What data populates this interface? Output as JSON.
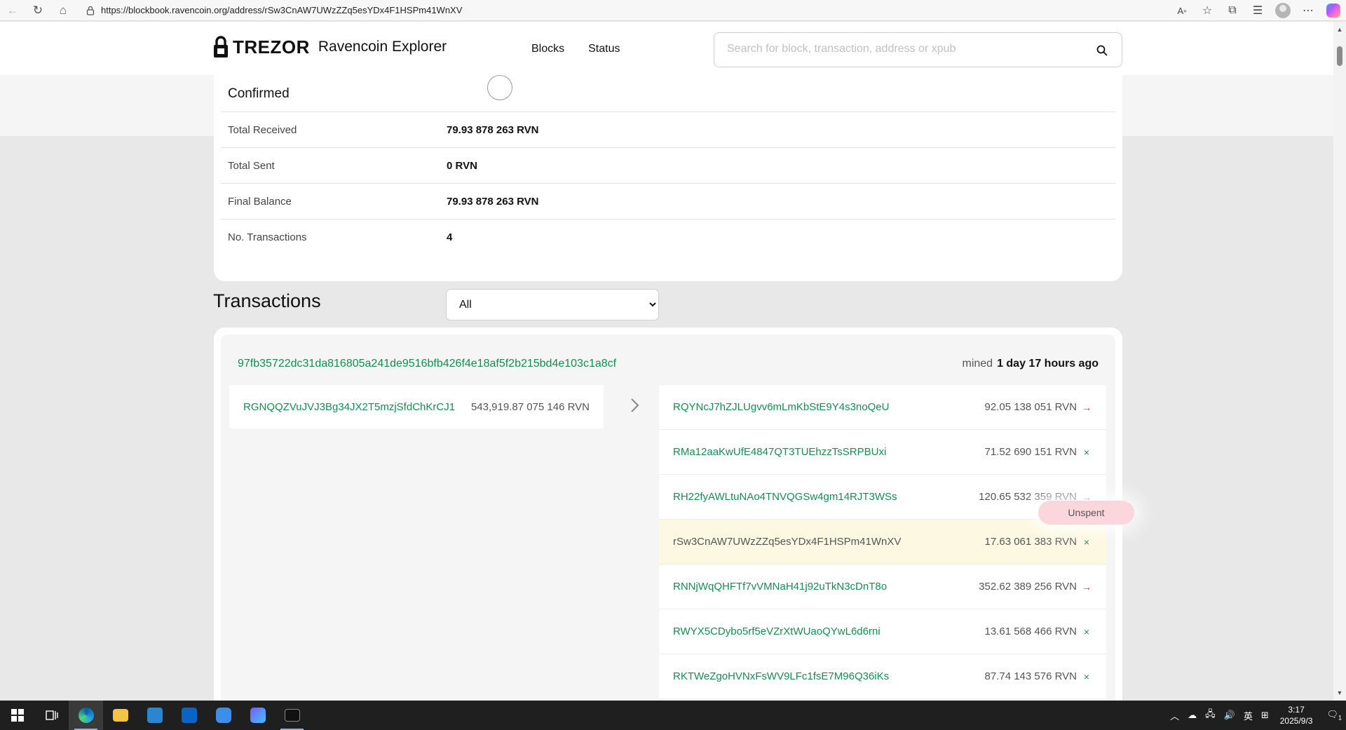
{
  "browser": {
    "url": "https://blockbook.ravencoin.org/address/rSw3CnAW7UWzZZq5esYDx4F1HSPm41WnXV"
  },
  "header": {
    "logo_text": "TREZOR",
    "subtitle": "Ravencoin Explorer",
    "nav": [
      "Blocks",
      "Status"
    ],
    "search_placeholder": "Search for block, transaction, address or xpub"
  },
  "confirmed": {
    "title": "Confirmed",
    "rows": [
      {
        "label": "Total Received",
        "value": "79.93 878 263 RVN"
      },
      {
        "label": "Total Sent",
        "value": "0 RVN"
      },
      {
        "label": "Final Balance",
        "value": "79.93 878 263 RVN"
      },
      {
        "label": "No. Transactions",
        "value": "4"
      }
    ]
  },
  "transactions": {
    "heading": "Transactions",
    "filter_selected": "All",
    "tx": {
      "hash": "97fb35722dc31da816805a241de9516bfb426f4e18af5f2b215bd4e103c1a8cf",
      "mined_label": "mined",
      "mined_ago": "1 day 17 hours ago",
      "input": {
        "address": "RGNQQZVuJVJ3Bg34JX2T5mzjSfdChKrCJ1",
        "amount": "543,919.87 075 146 RVN"
      },
      "outputs": [
        {
          "address": "RQYNcJ7hZJLUgvv6mLmKbStE9Y4s3noQeU",
          "amount": "92.05 138 051 RVN",
          "status": "spent",
          "mark": "→"
        },
        {
          "address": "RMa12aaKwUfE4847QT3TUEhzzTsSRPBUxi",
          "amount": "71.52 690 151 RVN",
          "status": "unspent",
          "mark": "×"
        },
        {
          "address": "RH22fyAWLtuNAo4TNVQGSw4gm14RJT3WSs",
          "amount": "120.65 532 359 RVN",
          "status": "spent",
          "mark": "→"
        },
        {
          "address": "rSw3CnAW7UWzZZq5esYDx4F1HSPm41WnXV",
          "amount": "17.63 061 383 RVN",
          "status": "unspent",
          "mark": "×"
        },
        {
          "address": "RNNjWqQHFTf7vVMNaH41j92uTkN3cDnT8o",
          "amount": "352.62 389 256 RVN",
          "status": "spent",
          "mark": "→"
        },
        {
          "address": "RWYX5CDybo5rf5eVZrXtWUaoQYwL6d6rni",
          "amount": "13.61 568 466 RVN",
          "status": "unspent",
          "mark": "×"
        },
        {
          "address": "RKTWeZgoHVNxFsWV9LFc1fsE7M96Q36iKs",
          "amount": "87.74 143 576 RVN",
          "status": "unspent",
          "mark": "×"
        }
      ]
    },
    "tooltip": "Unspent"
  },
  "taskbar": {
    "time": "3:17",
    "date": "2025/9/3",
    "ime": "英",
    "notification_count": "1"
  },
  "colors": {
    "link_green": "#168c53",
    "spent_red": "#d9303e",
    "highlight_row": "#fdf8e1",
    "tooltip_pink": "#fbd7dd"
  }
}
